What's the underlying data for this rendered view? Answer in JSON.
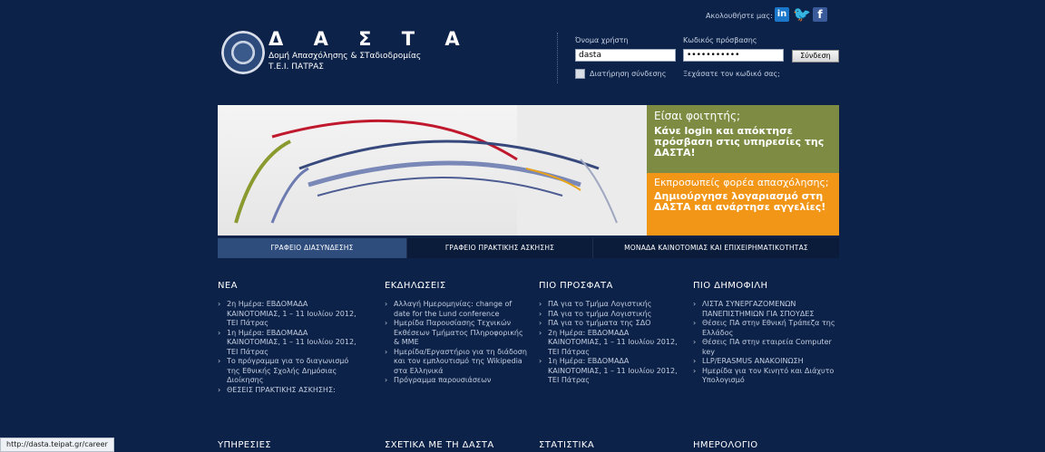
{
  "header": {
    "brand_title": "Δ Α Σ Τ Α",
    "brand_sub1": "Δομή Απασχόλησης & ΣΤαδιοδρομίας",
    "brand_sub2": "Τ.Ε.Ι. ΠΑΤΡΑΣ",
    "follow_label": "Ακολουθήστε μας:"
  },
  "login": {
    "username_label": "Όνομα χρήστη",
    "username_value": "dasta",
    "password_label": "Κωδικός πρόσβασης",
    "password_value": "•••••••••••",
    "submit_label": "Σύνδεση",
    "remember_label": "Διατήρηση σύνδεσης",
    "forgot_label": "Ξεχάσατε τον κωδικό σας;"
  },
  "promo": {
    "student_question": "Είσαι φοιτητής;",
    "student_cta": "Κάνε login και απόκτησε πρόσβαση στις υπηρεσίες της ΔΑΣΤΑ!",
    "employer_question": "Εκπροσωπείς φορέα απασχόλησης;",
    "employer_cta": "Δημιούργησε λογαριασμό στη ΔΑΣΤΑ και ανάρτησε αγγελίες!"
  },
  "tabs": [
    {
      "label": "ΓΡΑΦΕΙΟ ΔΙΑΣΥΝΔΕΣΗΣ"
    },
    {
      "label": "ΓΡΑΦΕΙΟ ΠΡΑΚΤΙΚΗΣ ΑΣΚΗΣΗΣ"
    },
    {
      "label": "ΜΟΝΑΔΑ ΚΑΙΝΟΤΟΜΙΑΣ ΚΑΙ ΕΠΙΧΕΙΡΗΜΑΤΙΚΟΤΗΤΑΣ"
    }
  ],
  "columns": [
    {
      "title": "ΝΕΑ",
      "items": [
        "2η Ημέρα: ΕΒΔΟΜΑΔΑ ΚΑΙΝΟΤΟΜΙΑΣ, 1 – 11 Ιουλίου 2012, ΤΕΙ Πάτρας",
        "1η Ημέρα: ΕΒΔΟΜΑΔΑ ΚΑΙΝΟΤΟΜΙΑΣ, 1 – 11 Ιουλίου 2012, ΤΕΙ Πάτρας",
        "Το πρόγραμμα για το διαγωνισμό της Εθνικής Σχολής Δημόσιας Διοίκησης",
        "ΘΕΣΕΙΣ ΠΡΑΚΤΙΚΗΣ ΑΣΚΗΣΗΣ:"
      ]
    },
    {
      "title": "ΕΚΔΗΛΩΣΕΙΣ",
      "items": [
        "Αλλαγή Ημερομηνίας: change of date for the Lund conference",
        "Ημερίδα Παρουσίασης Τεχνικών Εκθέσεων Τμήματος Πληροφορικής & ΜΜΕ",
        "Ημερίδα/Εργαστήριο για τη διάδοση και τον εμπλουτισμό της Wikipedia στα Ελληνικά",
        "Πρόγραμμα παρουσιάσεων"
      ]
    },
    {
      "title": "ΠΙΟ ΠΡΟΣΦΑΤΑ",
      "items": [
        "ΠΑ για το Τμήμα Λογιστικής",
        "ΠΑ για το τμήμα Λογιστικής",
        "ΠΑ για το τμήματα της ΣΔΟ",
        "2η Ημέρα: ΕΒΔΟΜΑΔΑ ΚΑΙΝΟΤΟΜΙΑΣ, 1 – 11 Ιουλίου 2012, ΤΕΙ Πάτρας",
        "1η Ημέρα: ΕΒΔΟΜΑΔΑ ΚΑΙΝΟΤΟΜΙΑΣ, 1 – 11 Ιουλίου 2012, ΤΕΙ Πάτρας"
      ]
    },
    {
      "title": "ΠΙΟ ΔΗΜΟΦΙΛΗ",
      "items": [
        "ΛΙΣΤΑ ΣΥΝΕΡΓΑΖΟΜΕΝΩΝ ΠΑΝΕΠΙΣΤΗΜΙΩΝ ΓΙΑ ΣΠΟΥΔΕΣ",
        "Θέσεις ΠΑ στην Εθνική Τράπεζα της Ελλάδος",
        "Θέσεις ΠΑ στην εταιρεία Computer key",
        "LLP/ERASMUS ΑΝΑΚΟΙΝΩΣΗ",
        "Ημερίδα για τον Κινητό και Διάχυτο Υπολογισμό"
      ]
    }
  ],
  "bottom_headers": [
    "ΥΠΗΡΕΣΙΕΣ",
    "ΣΧΕΤΙΚΑ ΜΕ ΤΗ ΔΑΣΤΑ",
    "ΣΤΑΤΙΣΤΙΚΑ",
    "ΗΜΕΡΟΛΟΓΙΟ"
  ],
  "status_bar": "http://dasta.teipat.gr/career",
  "colors": {
    "page_bg": "#0d2248",
    "green_panel": "#7e8b43",
    "orange_panel": "#f29618",
    "active_tab": "#2e4d7d"
  }
}
